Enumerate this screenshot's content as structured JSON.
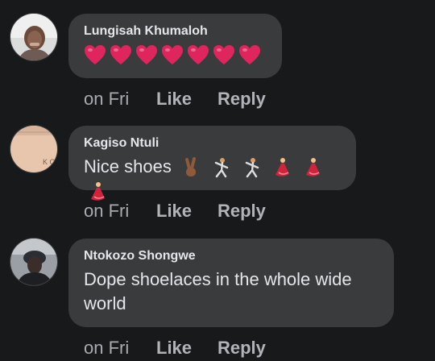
{
  "comments": [
    {
      "author": "Lungisah Khumaloh",
      "text": "",
      "emojis": [
        "red-heart",
        "red-heart",
        "red-heart",
        "red-heart",
        "red-heart",
        "red-heart",
        "red-heart"
      ],
      "time": "on Fri",
      "like_label": "Like",
      "reply_label": "Reply"
    },
    {
      "author": "Kagiso Ntuli",
      "text": "Nice shoes",
      "emojis": [
        "victory-hand",
        "man-dancing",
        "man-dancing",
        "woman-dancing",
        "woman-dancing",
        "woman-dancing"
      ],
      "time": "on Fri",
      "like_label": "Like",
      "reply_label": "Reply"
    },
    {
      "author": "Ntokozo Shongwe",
      "text": "Dope shoelaces in the whole wide world",
      "emojis": [],
      "time": "on Fri",
      "like_label": "Like",
      "reply_label": "Reply"
    }
  ],
  "colors": {
    "background": "#18191a",
    "bubble": "#3a3b3c",
    "text": "#e4e6eb",
    "muted": "#b0b3b8",
    "heart": "#e0245e"
  }
}
